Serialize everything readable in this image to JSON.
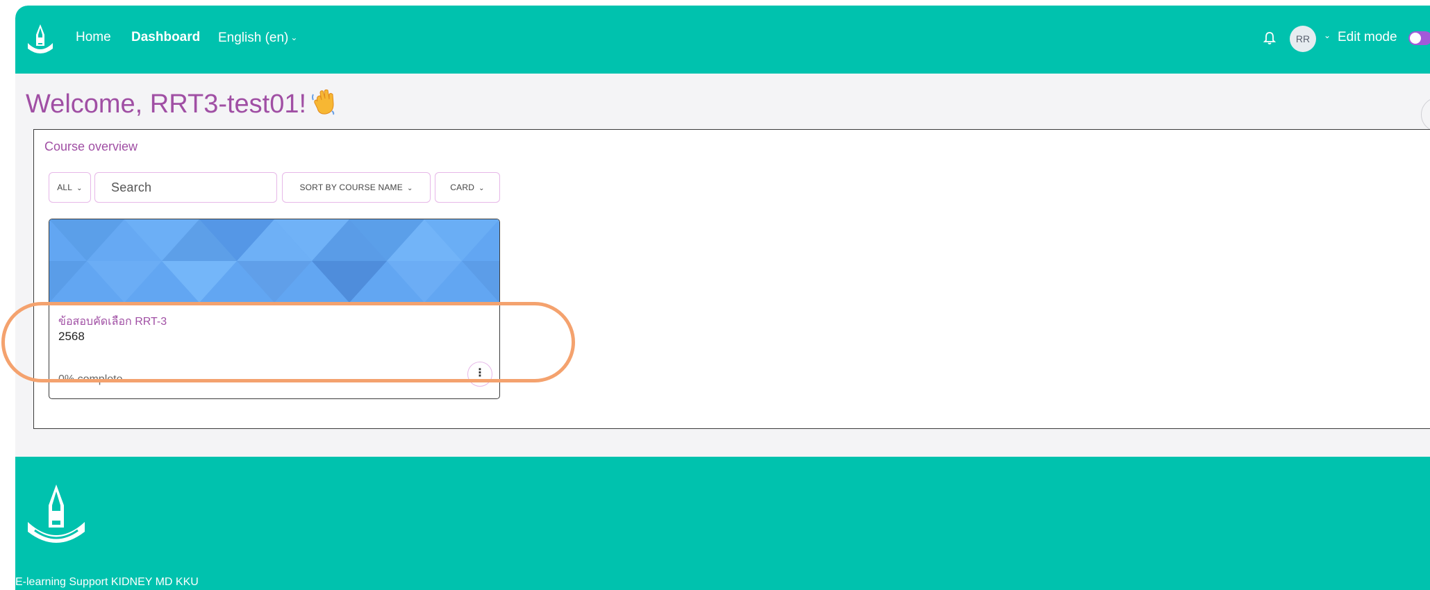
{
  "navbar": {
    "logo": "kku-medicine-logo",
    "items": [
      {
        "label": "Home"
      },
      {
        "label": "Dashboard"
      },
      {
        "label": "English (en)"
      }
    ],
    "avatar_initials": "RR",
    "edit_mode_label": "Edit mode",
    "edit_mode_on": false,
    "bg_color": "#00c2ae"
  },
  "welcome": {
    "text": "Welcome, RRT3-test01!",
    "emoji": "👋"
  },
  "course_overview": {
    "title": "Course overview",
    "filter_label": "ALL",
    "search_placeholder": "Search",
    "sort_label": "SORT BY COURSE NAME",
    "view_label": "CARD",
    "courses": [
      {
        "name": "ข้อสอบคัดเลือก RRT-3",
        "category": "2568",
        "progress_text": "0% complete",
        "progress": 0
      }
    ]
  },
  "footer": {
    "text": "E-learning Support KIDNEY MD KKU"
  },
  "colors": {
    "accent": "#a04fa4",
    "teal": "#00c2ae",
    "highlight": "#f4a26e"
  }
}
